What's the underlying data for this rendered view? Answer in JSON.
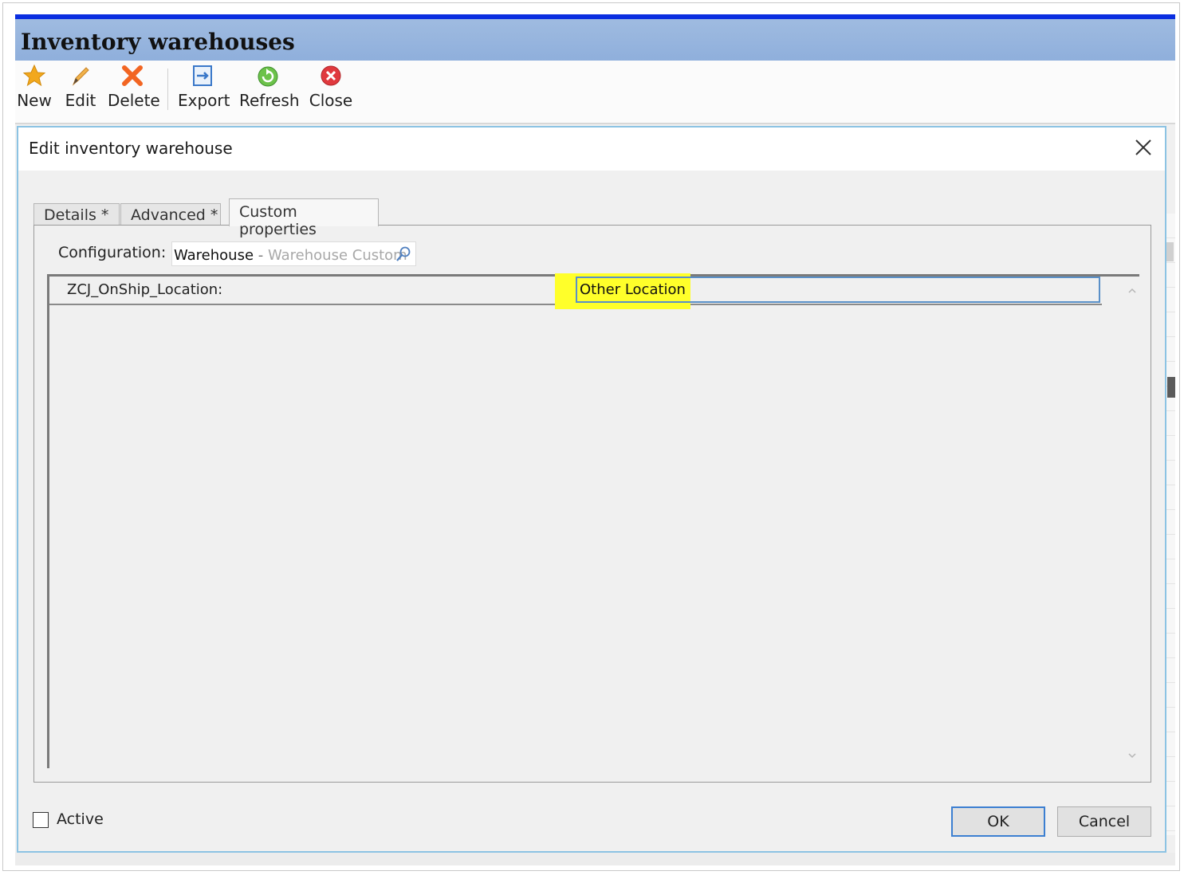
{
  "window": {
    "title": "Inventory warehouses",
    "accent_color": "#0a2ee0",
    "titlebar_color": "#9fbbe0"
  },
  "toolbar": {
    "buttons": [
      {
        "label": "New",
        "icon": "star-icon",
        "color": "#f2a81d"
      },
      {
        "label": "Edit",
        "icon": "pencil-icon",
        "color": "#e8a03a"
      },
      {
        "label": "Delete",
        "icon": "delete-x-icon",
        "color": "#f26522"
      },
      {
        "label": "Export",
        "icon": "export-icon",
        "color": "#3a78c9"
      },
      {
        "label": "Refresh",
        "icon": "refresh-icon",
        "color": "#58b947"
      },
      {
        "label": "Close",
        "icon": "close-circle-icon",
        "color": "#e0393e"
      }
    ]
  },
  "dialog": {
    "title": "Edit inventory warehouse",
    "close_icon": "close-icon",
    "tabs": [
      {
        "label": "Details *",
        "active": false
      },
      {
        "label": "Advanced *",
        "active": false
      },
      {
        "label": "Custom properties",
        "active": true
      }
    ],
    "configuration": {
      "label": "Configuration:",
      "value": "Warehouse",
      "separator": " - ",
      "description": "Warehouse Custom",
      "search_icon": "search-icon"
    },
    "properties": [
      {
        "name": "ZCJ_OnShip_Location:",
        "value": "Other Location",
        "highlight_color": "#ffff2a"
      }
    ],
    "active_checkbox": {
      "label": "Active",
      "checked": false
    },
    "ok_label": "OK",
    "cancel_label": "Cancel"
  }
}
